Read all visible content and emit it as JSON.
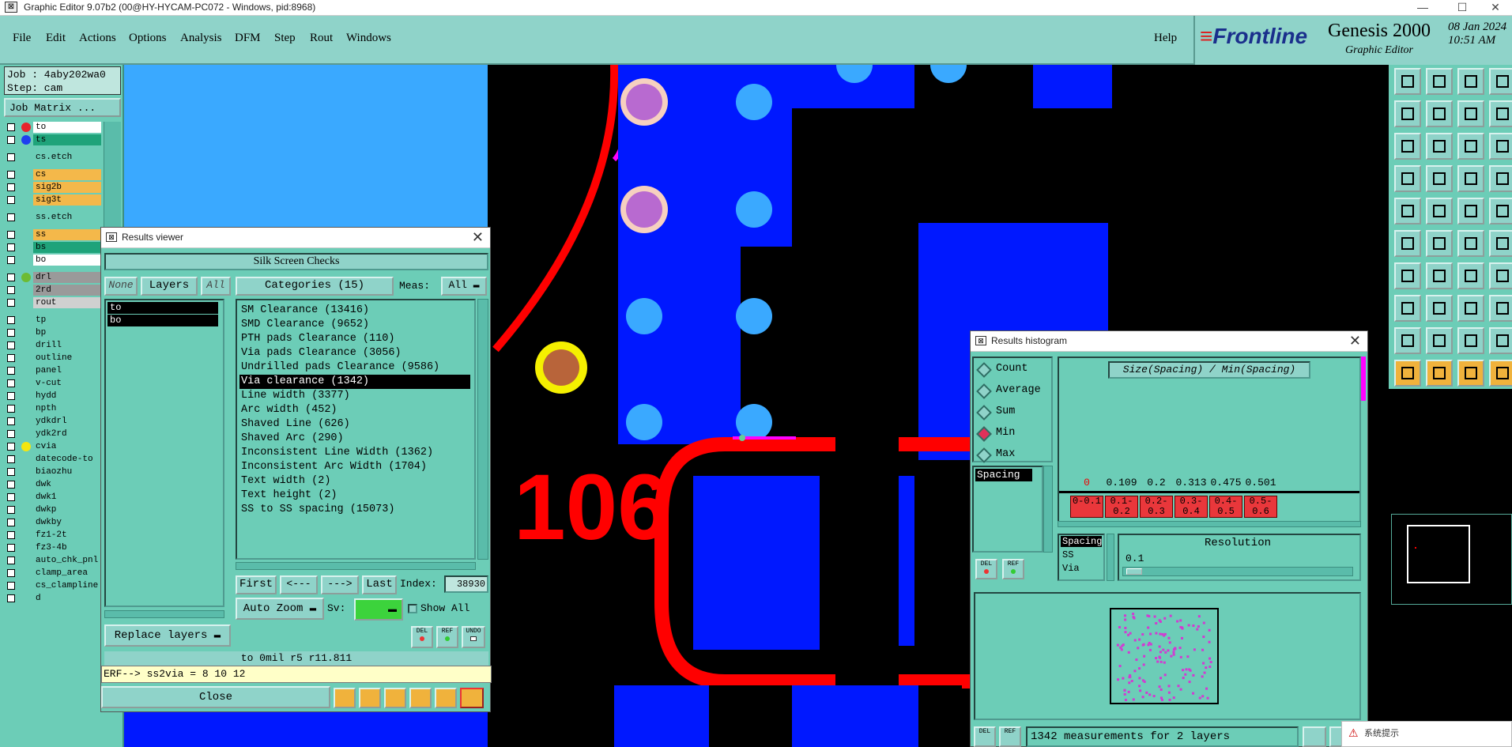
{
  "window": {
    "title": "Graphic Editor 9.07b2 (00@HY-HYCAM-PC072 - Windows, pid:8968)",
    "minimize": "—",
    "maximize": "☐",
    "close": "✕"
  },
  "menu": {
    "items": [
      "File",
      "Edit",
      "Actions",
      "Options",
      "Analysis",
      "DFM",
      "Step",
      "Rout",
      "Windows"
    ],
    "help": "Help"
  },
  "brand": {
    "frontline": "Frontline",
    "product": "Genesis 2000",
    "subtitle": "Graphic Editor",
    "date": "08 Jan 2024",
    "time": "10:51 AM"
  },
  "job": {
    "job_line": "Job : 4aby202wa0",
    "step_line": "Step: cam",
    "matrix_button": "Job Matrix ..."
  },
  "layers": [
    {
      "name": "to",
      "color": "#ffffff",
      "dot": "#e8232b"
    },
    {
      "name": "ts",
      "color": "#1fa37a",
      "dot": "#1f3ff0"
    },
    {
      "name": "cs.etch",
      "color": "#6ccdb7",
      "dot": ""
    },
    {
      "name": "cs",
      "color": "#f4b84a",
      "dot": ""
    },
    {
      "name": "sig2b",
      "color": "#f4b84a",
      "dot": ""
    },
    {
      "name": "sig3t",
      "color": "#f4b84a",
      "dot": ""
    },
    {
      "name": "ss.etch",
      "color": "#6ccdb7",
      "dot": ""
    },
    {
      "name": "ss",
      "color": "#f4b84a",
      "dot": ""
    },
    {
      "name": "bs",
      "color": "#1fa37a",
      "dot": ""
    },
    {
      "name": "bo",
      "color": "#ffffff",
      "dot": ""
    },
    {
      "name": "drl",
      "color": "#9a9a9a",
      "dot": "#6dbb33"
    },
    {
      "name": "2rd",
      "color": "#9a9a9a",
      "dot": ""
    },
    {
      "name": "rout",
      "color": "#d0d0d0",
      "dot": ""
    },
    {
      "name": "tp",
      "color": "#6ccdb7",
      "dot": ""
    },
    {
      "name": "bp",
      "color": "#6ccdb7",
      "dot": ""
    },
    {
      "name": "drill",
      "color": "#6ccdb7",
      "dot": ""
    },
    {
      "name": "outline",
      "color": "#6ccdb7",
      "dot": ""
    },
    {
      "name": "panel",
      "color": "#6ccdb7",
      "dot": ""
    },
    {
      "name": "v-cut",
      "color": "#6ccdb7",
      "dot": ""
    },
    {
      "name": "hydd",
      "color": "#6ccdb7",
      "dot": ""
    },
    {
      "name": "npth",
      "color": "#6ccdb7",
      "dot": ""
    },
    {
      "name": "ydkdrl",
      "color": "#6ccdb7",
      "dot": ""
    },
    {
      "name": "ydk2rd",
      "color": "#6ccdb7",
      "dot": ""
    },
    {
      "name": "cvia",
      "color": "#6ccdb7",
      "dot": "#f5e60f"
    },
    {
      "name": "datecode-to",
      "color": "#6ccdb7",
      "dot": ""
    },
    {
      "name": "biaozhu",
      "color": "#6ccdb7",
      "dot": ""
    },
    {
      "name": "dwk",
      "color": "#6ccdb7",
      "dot": ""
    },
    {
      "name": "dwk1",
      "color": "#6ccdb7",
      "dot": ""
    },
    {
      "name": "dwkp",
      "color": "#6ccdb7",
      "dot": ""
    },
    {
      "name": "dwkby",
      "color": "#6ccdb7",
      "dot": ""
    },
    {
      "name": "fz1-2t",
      "color": "#6ccdb7",
      "dot": ""
    },
    {
      "name": "fz3-4b",
      "color": "#6ccdb7",
      "dot": ""
    },
    {
      "name": "auto_chk_pnl",
      "color": "#6ccdb7",
      "dot": ""
    },
    {
      "name": "clamp_area",
      "color": "#6ccdb7",
      "dot": ""
    },
    {
      "name": "cs_clampline",
      "color": "#6ccdb7",
      "dot": ""
    },
    {
      "name": "d",
      "color": "#6ccdb7",
      "dot": ""
    }
  ],
  "results_viewer": {
    "title": "Results viewer",
    "header": "Silk Screen Checks",
    "none": "None",
    "layers": "Layers",
    "all": "All",
    "categories_btn": "Categories (15)",
    "meas_label": "Meas:",
    "meas_value": "All",
    "layer_items": [
      "to",
      "bo"
    ],
    "categories": [
      "SM Clearance (13416)",
      "SMD Clearance (9652)",
      "PTH pads Clearance (110)",
      "Via pads Clearance (3056)",
      "Undrilled pads Clearance (9586)",
      "Via clearance (1342)",
      "Line width (3377)",
      "Arc width (452)",
      "Shaved Line (626)",
      "Shaved Arc (290)",
      "Inconsistent Line Width (1362)",
      "Inconsistent Arc Width (1704)",
      "Text width (2)",
      "Text height (2)",
      "SS to SS spacing (15073)"
    ],
    "selected_index": 5,
    "first": "First",
    "prev": "<---",
    "next": "--->",
    "last": "Last",
    "index_label": "Index:",
    "index_value": "38930",
    "auto_zoom": "Auto Zoom",
    "sv_label": "Sv:",
    "show_all": "Show All",
    "replace_layers": "Replace layers",
    "del": "DEL",
    "ref": "REF",
    "undo": "UNDO",
    "status": "to 0mil  r5  r11.811",
    "erf": "ERF--> ss2via = 8 10 12",
    "close": "Close"
  },
  "histogram": {
    "title": "Results histogram",
    "options": [
      "Count",
      "Average",
      "Sum",
      "Min",
      "Max"
    ],
    "selected_option": "Min",
    "chart_title": "Size(Spacing) / Min(Spacing)",
    "attr_items": [
      "Spacing"
    ],
    "values": [
      "0",
      "0.109",
      "0.2",
      "0.313",
      "0.475",
      "0.501"
    ],
    "bins": [
      "0-\n0.1",
      "0.1-\n0.2",
      "0.2-\n0.3",
      "0.3-\n0.4",
      "0.4-\n0.5",
      "0.5-\n0.6"
    ],
    "res_list": [
      "Spacing",
      "SS",
      "Via"
    ],
    "resolution_label": "Resolution",
    "resolution_value": "0.1",
    "del": "DEL",
    "ref": "REF",
    "summary": "1342 measurements for 2 layers"
  },
  "toast": {
    "text": "系统提示"
  },
  "canvas": {
    "label": "106"
  }
}
